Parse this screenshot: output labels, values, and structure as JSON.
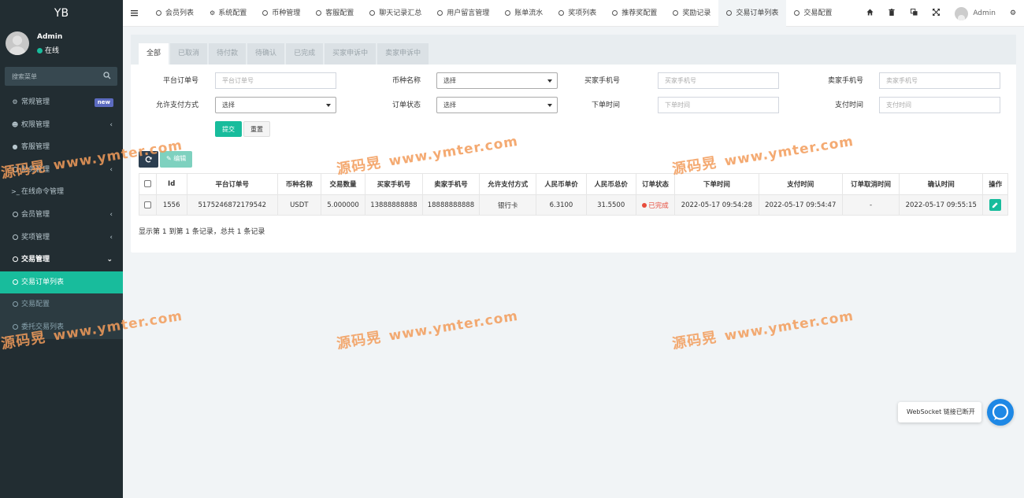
{
  "sidebar": {
    "logo": "YB",
    "user_name": "Admin",
    "user_status": "在线",
    "search_placeholder": "搜索菜单",
    "items": [
      {
        "label": "常规管理",
        "icon": "cogs-icon",
        "badge": "new"
      },
      {
        "label": "权限管理",
        "icon": "group-icon",
        "arrow": "‹"
      },
      {
        "label": "客服管理",
        "icon": "comment-icon"
      },
      {
        "label": "财务管理",
        "icon": "circle-icon",
        "arrow": "‹"
      },
      {
        "label": "在线命令管理",
        "icon": "terminal-icon"
      },
      {
        "label": "会员管理",
        "icon": "circle-icon",
        "arrow": "‹"
      },
      {
        "label": "奖项管理",
        "icon": "circle-icon",
        "arrow": "‹"
      },
      {
        "label": "交易管理",
        "icon": "circle-icon",
        "arrow": "⌄"
      },
      {
        "label": "交易订单列表",
        "icon": "circle-icon"
      },
      {
        "label": "交易配置",
        "icon": "circle-icon"
      },
      {
        "label": "委托交易列表",
        "icon": "circle-icon"
      }
    ]
  },
  "topnav": {
    "tabs": [
      {
        "label": "会员列表",
        "icon": "circle-icon"
      },
      {
        "label": "系统配置",
        "icon": "gear-icon"
      },
      {
        "label": "币种管理",
        "icon": "circle-icon"
      },
      {
        "label": "客服配置",
        "icon": "circle-icon"
      },
      {
        "label": "聊天记录汇总",
        "icon": "circle-icon"
      },
      {
        "label": "用户留言管理",
        "icon": "circle-icon"
      },
      {
        "label": "账单流水",
        "icon": "circle-icon"
      },
      {
        "label": "奖项列表",
        "icon": "circle-icon"
      },
      {
        "label": "推荐奖配置",
        "icon": "circle-icon"
      },
      {
        "label": "奖励记录",
        "icon": "circle-icon"
      },
      {
        "label": "交易订单列表",
        "icon": "circle-icon"
      },
      {
        "label": "交易配置",
        "icon": "circle-icon"
      }
    ],
    "user": "Admin"
  },
  "filter_tabs": [
    "全部",
    "已取消",
    "待付款",
    "待确认",
    "已完成",
    "买家申诉中",
    "卖家申诉中"
  ],
  "form": {
    "order_no_label": "平台订单号",
    "order_no_placeholder": "平台订单号",
    "coin_label": "币种名称",
    "coin_value": "选择",
    "buyer_label": "买家手机号",
    "buyer_placeholder": "买家手机号",
    "seller_label": "卖家手机号",
    "seller_placeholder": "卖家手机号",
    "pay_label": "允许支付方式",
    "pay_value": "选择",
    "status_label": "订单状态",
    "status_value": "选择",
    "order_time_label": "下单时间",
    "order_time_placeholder": "下单时间",
    "pay_time_label": "支付时间",
    "pay_time_placeholder": "支付时间",
    "submit": "提交",
    "reset": "重置"
  },
  "toolbar": {
    "edit": "编辑"
  },
  "table": {
    "headers": [
      "Id",
      "平台订单号",
      "币种名称",
      "交易数量",
      "买家手机号",
      "卖家手机号",
      "允许支付方式",
      "人民币单价",
      "人民币总价",
      "订单状态",
      "下单时间",
      "支付时间",
      "订单取消时间",
      "确认时间",
      "操作"
    ],
    "rows": [
      [
        "1556",
        "5175246872179542",
        "USDT",
        "5.000000",
        "13888888888",
        "18888888888",
        "银行卡",
        "6.3100",
        "31.5500",
        "已完成",
        "2022-05-17 09:54:28",
        "2022-05-17 09:54:47",
        "-",
        "2022-05-17 09:55:15"
      ]
    ]
  },
  "summary": "显示第 1 到第 1 条记录，总共 1 条记录",
  "watermark": {
    "cn": "源码晃",
    "url": "www.ymter.com"
  },
  "toast": "WebSocket 链接已断开",
  "colors": {
    "accent": "#18bc9c",
    "sidebar": "#222d32",
    "danger": "#e74c3c"
  }
}
